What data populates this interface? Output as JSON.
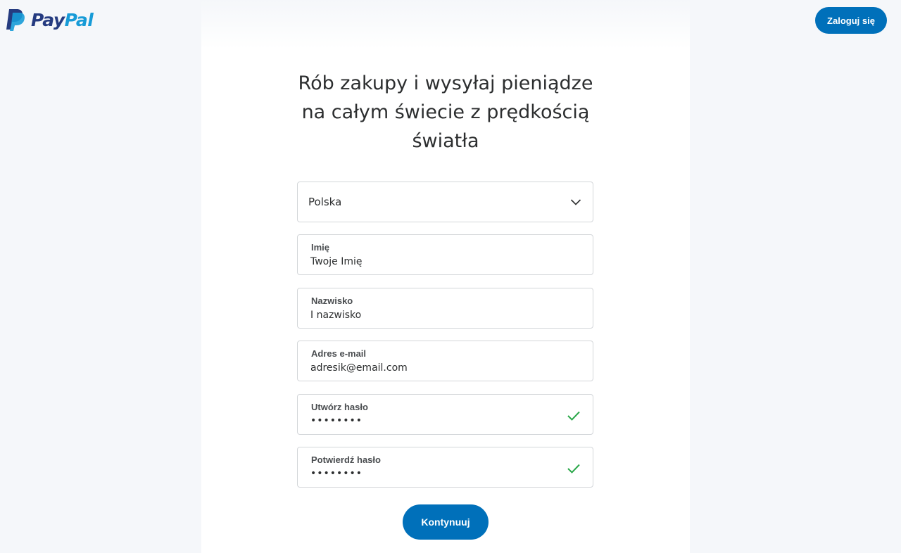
{
  "brand": {
    "logo_pay": "Pay",
    "logo_pal": "Pal",
    "colors": {
      "primary": "#0070ba",
      "logo_dark": "#253b80",
      "logo_light": "#179bd7",
      "check": "#2ba84a"
    }
  },
  "header": {
    "login_label": "Zaloguj się"
  },
  "headline": {
    "line1": "Rób zakupy i wysyłaj pieniądze",
    "line2": "na całym świecie z prędkością",
    "line3": "światła"
  },
  "form": {
    "country": {
      "value": "Polska",
      "icon": "chevron-down-icon"
    },
    "first_name": {
      "label": "Imię",
      "value": "Twoje Imię"
    },
    "last_name": {
      "label": "Nazwisko",
      "value": "I nazwisko"
    },
    "email": {
      "label": "Adres e-mail",
      "value": "adresik@email.com"
    },
    "password": {
      "label": "Utwórz hasło",
      "value": "••••••••",
      "icon": "checkmark-icon"
    },
    "password_confirm": {
      "label": "Potwierdź hasło",
      "value": "••••••••",
      "icon": "checkmark-icon"
    },
    "continue_label": "Kontynuuj"
  }
}
